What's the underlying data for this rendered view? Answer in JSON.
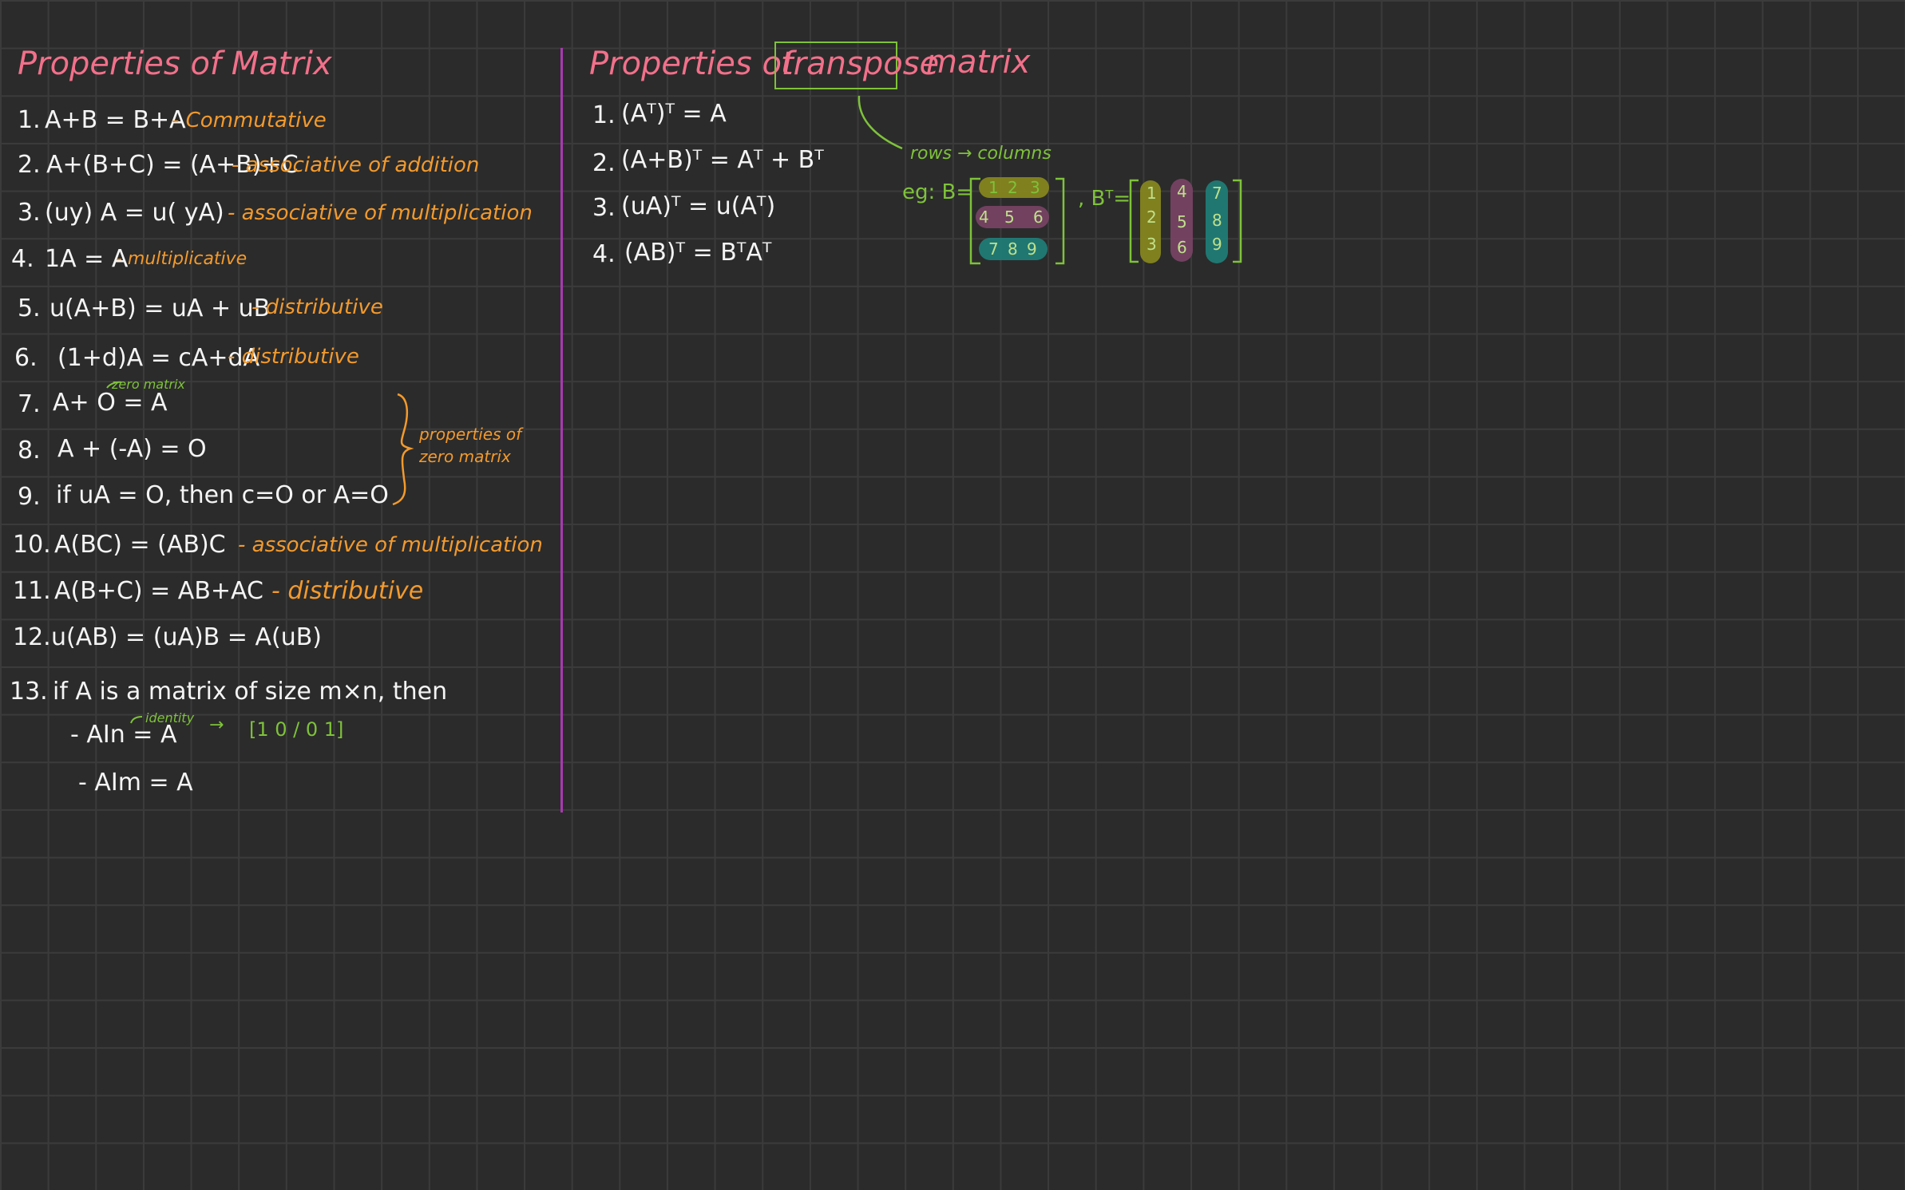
{
  "left": {
    "title": "Properties of Matrix",
    "items": [
      {
        "n": "1.",
        "expr": "A+B = B+A",
        "note": "- Commutative"
      },
      {
        "n": "2.",
        "expr": "A+(B+C) = (A+B)+C",
        "note": "- associative of addition"
      },
      {
        "n": "3.",
        "expr": "(uy) A = u( yA)",
        "note": "- associative of multiplication"
      },
      {
        "n": "4.",
        "expr": "1A = A",
        "note": "- multiplicative"
      },
      {
        "n": "5.",
        "expr": "u(A+B) = uA + uB",
        "note": "- distributive"
      },
      {
        "n": "6.",
        "expr": "(1+d)A = cA+dA",
        "note": "- distributive"
      },
      {
        "n": "7.",
        "expr": "A+ O  = A",
        "note": ""
      },
      {
        "n": "8.",
        "expr": "A + (-A) = O",
        "note": ""
      },
      {
        "n": "9.",
        "expr": "if uA = O, then c=O or A=O",
        "note": ""
      },
      {
        "n": "10.",
        "expr": "A(BC) = (AB)C",
        "note": "- associative of multiplication"
      },
      {
        "n": "11.",
        "expr": "A(B+C) = AB+AC",
        "note": "- distributive"
      },
      {
        "n": "12.",
        "expr": "u(AB) = (uA)B = A(uB)",
        "note": ""
      },
      {
        "n": "13.",
        "expr": "if A is a matrix of size m×n, then",
        "note": ""
      }
    ],
    "zero_matrix_label": "zero matrix",
    "bracket_note": "properties of zero matrix",
    "sub1": "- AIn = A",
    "identity_label": "identity",
    "identity_arrow": "→",
    "identity_matrix": "[1 0 / 0 1]",
    "sub2": "- AIm = A"
  },
  "right": {
    "title_prefix": "Properties of",
    "title_boxed": "transpose",
    "title_suffix": "matrix",
    "items": [
      {
        "n": "1.",
        "expr": "(Aᵀ)ᵀ = A"
      },
      {
        "n": "2.",
        "expr": "(A+B)ᵀ = Aᵀ + Bᵀ"
      },
      {
        "n": "3.",
        "expr": "(uA)ᵀ = u(Aᵀ)"
      },
      {
        "n": "4.",
        "expr": "(AB)ᵀ = BᵀAᵀ"
      }
    ],
    "rows_note": "rows → columns",
    "eg_label": "eg: B=",
    "bt_label": ", Bᵀ=",
    "b_rows": [
      [
        "1",
        "2",
        "3"
      ],
      [
        "4",
        "5",
        "6"
      ],
      [
        "7",
        "8",
        "9"
      ]
    ],
    "bt_cols": [
      [
        "1",
        "2",
        "3"
      ],
      [
        "4",
        "5",
        "6"
      ],
      [
        "7",
        "8",
        "9"
      ]
    ]
  },
  "colors": {
    "background": "#2b2b2b",
    "grid": "#3b3b3b",
    "title": "#f2708a",
    "annotation": "#f39a2c",
    "green": "#7ec23a",
    "divider": "#a83ab0",
    "hl_yellow": "#8a8a1e",
    "hl_purple": "#7a4466",
    "hl_teal": "#1f7f7a"
  }
}
